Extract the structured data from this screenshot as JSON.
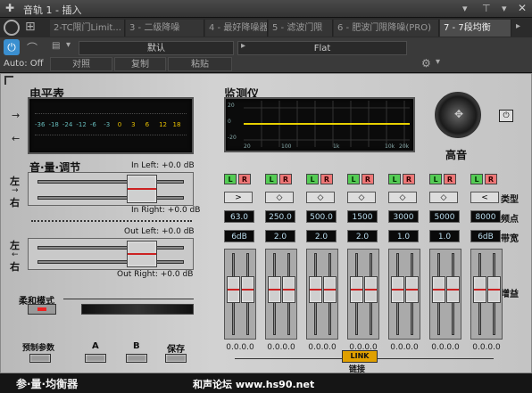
{
  "title": "音轨 1 - 插入",
  "tabs": [
    {
      "label": "2-TC限门Limit..."
    },
    {
      "label": "3 - 二级降噪"
    },
    {
      "label": "4 - 最好降噪器"
    },
    {
      "label": "5 - 滤波门限"
    },
    {
      "label": "6 - 肥波门限降噪(PRO)"
    },
    {
      "label": "7 - 7段均衡"
    }
  ],
  "header": {
    "preset": "默认",
    "preset2": "Flat",
    "auto": "Auto: Off",
    "compare": "对照",
    "copy": "复制",
    "paste": "粘贴"
  },
  "plugin": {
    "level_meter": "电平表",
    "monitor": "监测仪",
    "high_quality": "高音",
    "volume_adjust": "音·量·调节",
    "in_left": "In Left: +0.0 dB",
    "in_right": "In Right: +0.0 dB",
    "out_left": "Out Left: +0.0 dB",
    "out_right": "Out Right: +0.0 dB",
    "left_right_1a": "左",
    "left_right_1b": "右",
    "left_right_2a": "左",
    "left_right_2b": "右",
    "soft_mode": "柔和模式",
    "preset": "预制参数",
    "a": "A",
    "b": "B",
    "save": "保存",
    "type_label": "类型",
    "freq_label": "频点",
    "bw_label": "带宽",
    "gain_label": "增益",
    "link": "LINK",
    "link_label": "链接",
    "meter_scale": [
      "-36",
      "-18",
      "-24",
      "-12",
      "-6",
      "-3",
      "0",
      "3",
      "6",
      "12",
      "18"
    ],
    "monitor_x": [
      "20",
      "100",
      "1k",
      "10k",
      "20k"
    ],
    "monitor_y": [
      "20",
      "0",
      "-20"
    ],
    "bands": [
      {
        "type": ">",
        "freq": "63.0",
        "bw": "6dB",
        "gain": "0.0.0.0"
      },
      {
        "type": "◇",
        "freq": "250.0",
        "bw": "2.0",
        "gain": "0.0.0.0"
      },
      {
        "type": "◇",
        "freq": "500.0",
        "bw": "2.0",
        "gain": "0.0.0.0"
      },
      {
        "type": "◇",
        "freq": "1500",
        "bw": "2.0",
        "gain": "0.0.0.0"
      },
      {
        "type": "◇",
        "freq": "3000",
        "bw": "1.0",
        "gain": "0.0.0.0"
      },
      {
        "type": "◇",
        "freq": "5000",
        "bw": "1.0",
        "gain": "0.0.0.0"
      },
      {
        "type": "<",
        "freq": "8000",
        "bw": "6dB",
        "gain": "0.0.0.0"
      }
    ]
  },
  "footer": {
    "name": "参·量·均衡器",
    "watermark": "和声论坛 www.hs90.net"
  }
}
